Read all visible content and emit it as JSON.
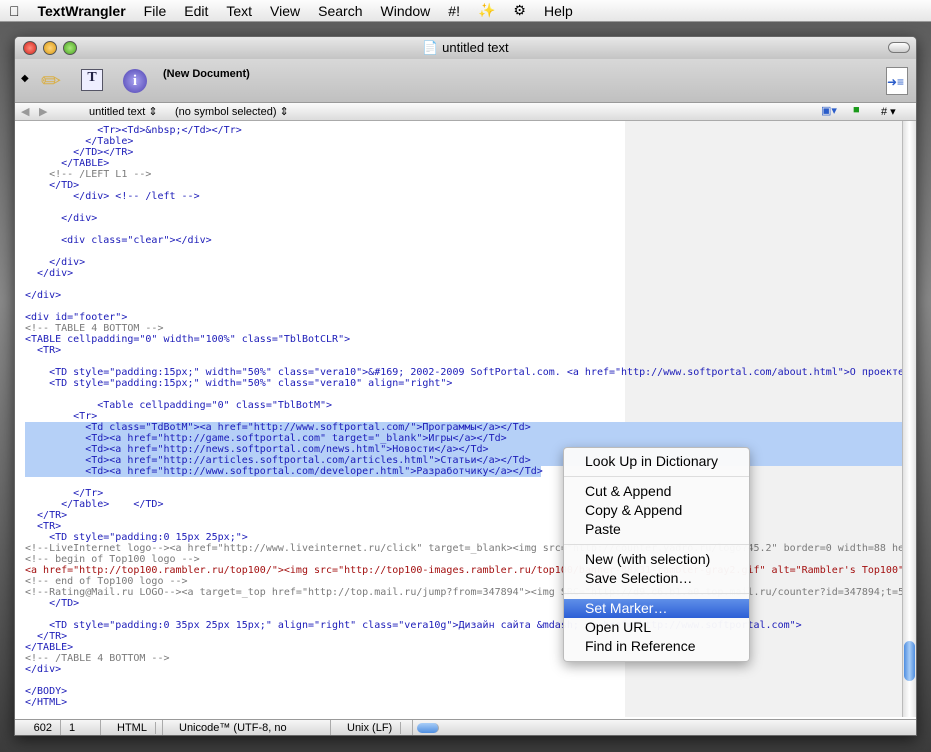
{
  "menubar": {
    "app": "TextWrangler",
    "items": [
      "File",
      "Edit",
      "Text",
      "View",
      "Search",
      "Window",
      "#!",
      "Help"
    ]
  },
  "window": {
    "title": "untitled text"
  },
  "toolbar": {
    "doc_label": "(New Document)"
  },
  "navbar": {
    "file_popup": "untitled text",
    "symbol_popup": "(no symbol selected)",
    "hash": "#"
  },
  "editor": {
    "lines": [
      "            <Tr><Td>&nbsp;</Td></Tr>",
      "          </Table>",
      "        </TD></TR>",
      "      </TABLE>",
      "    <!-- /LEFT L1 -->",
      "    </TD>",
      "        </div> <!-- /left -->",
      "",
      "      </div>",
      "",
      "      <div class=\"clear\"></div>",
      "",
      "    </div>",
      "  </div>",
      "",
      "</div>",
      "",
      "<div id=\"footer\">",
      "<!-- TABLE 4 BOTTOM -->",
      "<TABLE cellpadding=\"0\" width=\"100%\" class=\"TblBotCLR\">",
      "  <TR>",
      "",
      "    <TD style=\"padding:15px;\" width=\"50%\" class=\"vera10\">&#169; 2002-2009 SoftPortal.com. <a href=\"http://www.softportal.com/about.html\">О проекте</a>",
      "    <TD style=\"padding:15px;\" width=\"50%\" class=\"vera10\" align=\"right\">",
      "",
      "            <Table cellpadding=\"0\" class=\"TblBotM\">",
      "        <Tr>",
      "          <Td class=\"TdBotM\"><a href=\"http://www.softportal.com/\">Программы</a></Td>",
      "          <Td><a href=\"http://game.softportal.com\" target=\"_blank\">Игры</a></Td>",
      "          <Td><a href=\"http://news.softportal.com/news.html\">Новости</a></Td>",
      "          <Td><a href=\"http://articles.softportal.com/articles.html\">Статьи</a></Td>",
      "          <Td><a href=\"http://www.softportal.com/developer.html\">Разработчику</a></Td>",
      "",
      "        </Tr>",
      "      </Table>    </TD>",
      "  </TR>",
      "  <TR>",
      "    <TD style=\"padding:0 15px 25px;\">",
      "<!--LiveInternet logo--><a href=\"http://www.liveinternet.ru/click\" target=_blank><img src=\"http://counter.yadro.ru/logo?45.2\" border=0 width=88 he",
      "<!-- begin of Top100 logo -->",
      "<a href=\"http://top100.rambler.ru/top100/\"><img src=\"http://top100-images.rambler.ru/top100/banner-88x31-rambler-gray2.gif\" alt=\"Rambler's Top100\"",
      "<!-- end of Top100 logo -->",
      "<!--Rating@Mail.ru LOGO--><a target=_top href=\"http://top.mail.ru/jump?from=347894\"><img SRC=\"http://d9.c6.b1.a0.top.mail.ru/counter?id=347894;t=5",
      "    </TD>",
      "",
      "    <TD style=\"padding:0 35px 25px 15px;\" align=\"right\" class=\"vera10g\">Дизайн сайта &mdash; <a href=\"http://www.softportal.com\">",
      "  </TR>",
      "</TABLE>",
      "<!-- /TABLE 4 BOTTOM -->",
      "</div>",
      "",
      "</BODY>",
      "</HTML>"
    ],
    "selected_from": 27,
    "selected_to": 31
  },
  "status": {
    "line": "602",
    "col": "1",
    "language": "HTML",
    "encoding": "Unicode™ (UTF-8, no BOM)",
    "line_endings": "Unix (LF)"
  },
  "context_menu": {
    "items": [
      "Look Up in Dictionary",
      "Cut & Append",
      "Copy & Append",
      "Paste",
      "New (with selection)",
      "Save Selection…",
      "Set Marker…",
      "Open URL",
      "Find in Reference"
    ],
    "highlighted": "Set Marker…"
  }
}
